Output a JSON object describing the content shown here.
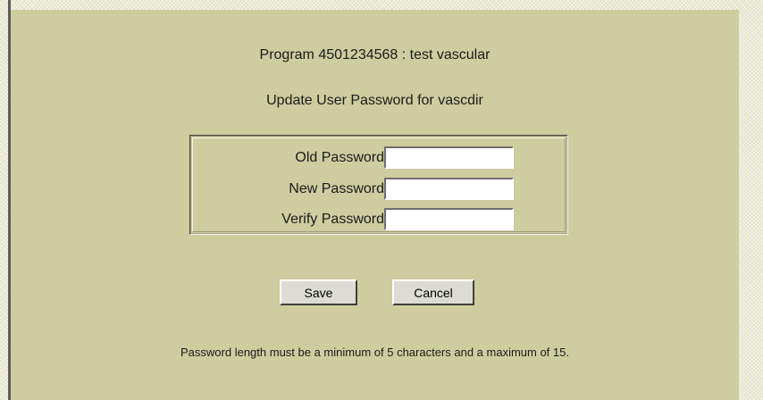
{
  "header": {
    "program_line": "Program 4501234568 : test vascular",
    "subtitle": "Update User Password for vascdir"
  },
  "form": {
    "fields": [
      {
        "label": "Old Password",
        "value": ""
      },
      {
        "label": "New Password",
        "value": ""
      },
      {
        "label": "Verify Password",
        "value": ""
      }
    ]
  },
  "buttons": {
    "save_label": "Save",
    "cancel_label": "Cancel"
  },
  "note": "Password length must be a minimum of 5 characters and a maximum of 15.",
  "colors": {
    "panel": "#cdcd9f",
    "background": "#ecebd8",
    "button_face": "#dcdcd4"
  }
}
